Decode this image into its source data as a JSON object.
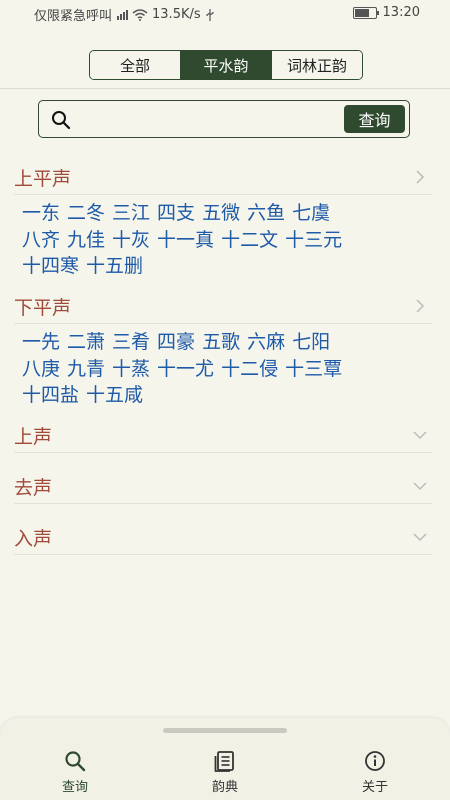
{
  "status_bar": {
    "carrier": "仅限紧急呼叫",
    "speed": "13.5K/s",
    "time": "13:20"
  },
  "tabs": [
    {
      "label": "全部",
      "active": false
    },
    {
      "label": "平水韵",
      "active": true
    },
    {
      "label": "词林正韵",
      "active": false
    }
  ],
  "search": {
    "placeholder": "",
    "button_label": "查询"
  },
  "sections": [
    {
      "title": "上平声",
      "expanded": true,
      "rhymes": [
        "一东",
        "二冬",
        "三江",
        "四支",
        "五微",
        "六鱼",
        "七虞",
        "八齐",
        "九佳",
        "十灰",
        "十一真",
        "十二文",
        "十三元",
        "十四寒",
        "十五删"
      ]
    },
    {
      "title": "下平声",
      "expanded": true,
      "rhymes": [
        "一先",
        "二萧",
        "三肴",
        "四豪",
        "五歌",
        "六麻",
        "七阳",
        "八庚",
        "九青",
        "十蒸",
        "十一尤",
        "十二侵",
        "十三覃",
        "十四盐",
        "十五咸"
      ]
    },
    {
      "title": "上声",
      "expanded": false,
      "rhymes": []
    },
    {
      "title": "去声",
      "expanded": false,
      "rhymes": []
    },
    {
      "title": "入声",
      "expanded": false,
      "rhymes": []
    }
  ],
  "nav": [
    {
      "label": "查询",
      "icon": "search-icon",
      "active": true
    },
    {
      "label": "韵典",
      "icon": "book-icon",
      "active": false
    },
    {
      "label": "关于",
      "icon": "info-icon",
      "active": false
    }
  ],
  "colors": {
    "accent": "#2f4a2f",
    "section_title": "#a04a3a",
    "rhyme_link": "#1e5aa8",
    "background": "#f5f5ec"
  }
}
